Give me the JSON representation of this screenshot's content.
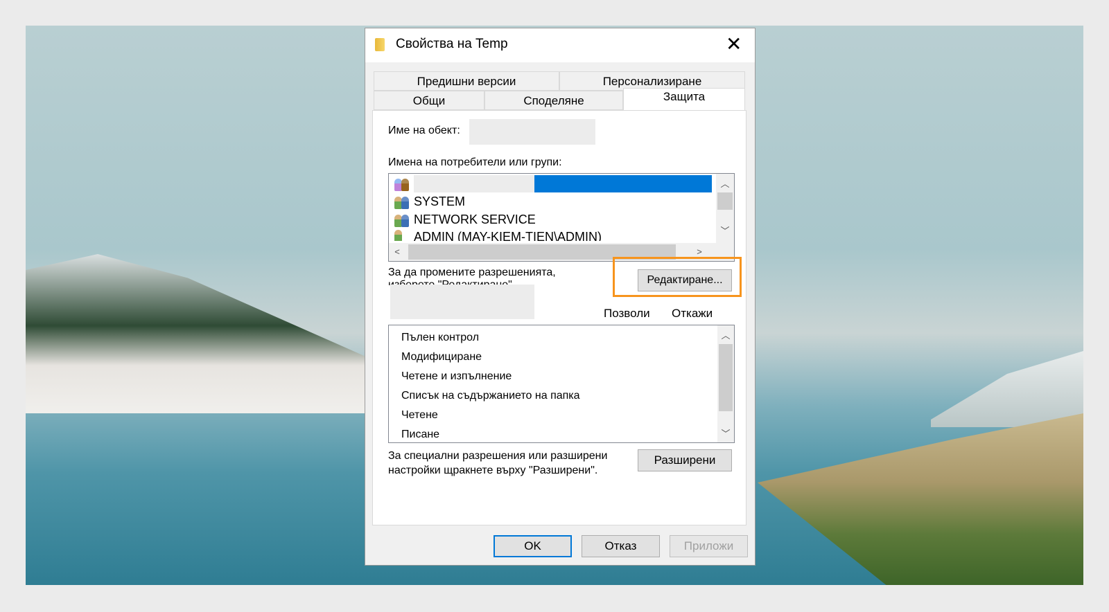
{
  "window": {
    "title": "Свойства на Temp",
    "close": "✕"
  },
  "tabs": {
    "row1": [
      "Предишни версии",
      "Персонализиране"
    ],
    "row2": [
      "Общи",
      "Споделяне",
      "Защита"
    ],
    "active": "Защита"
  },
  "security": {
    "object_name_label": "Име на обект:",
    "users_label": "Имена на потребители или групи:",
    "users": [
      "SYSTEM",
      "NETWORK SERVICE",
      "ADMIN (MAY-KIEM-TIEN\\ADMIN)"
    ],
    "change_hint_line1": "За да промените разрешенията,",
    "change_hint_line2": "изберете \"Редактиране\".",
    "edit_button": "Редактиране...",
    "allow_header": "Позволи",
    "deny_header": "Откажи",
    "permissions": [
      "Пълен контрол",
      "Модифициране",
      "Четене и изпълнение",
      "Списък на съдържанието на папка",
      "Четене",
      "Писане"
    ],
    "advanced_hint_line1": "За специални разрешения или разширени",
    "advanced_hint_line2": "настройки щракнете върху \"Разширени\".",
    "advanced_button": "Разширени"
  },
  "footer": {
    "ok": "OK",
    "cancel": "Отказ",
    "apply": "Приложи"
  },
  "colors": {
    "selection": "#0078d7",
    "highlight": "#f7941d"
  }
}
